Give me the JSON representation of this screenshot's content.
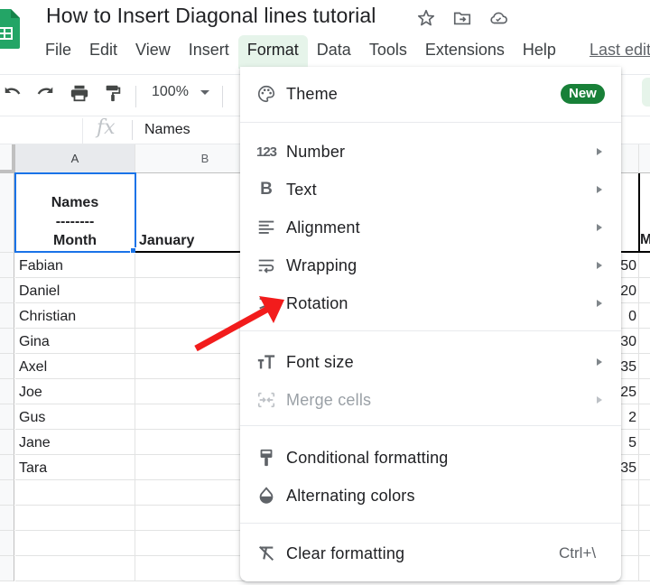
{
  "app": {
    "title": "How to Insert Diagonal lines tutorial",
    "title_icons": [
      "star-icon",
      "move-to-folder-icon",
      "cloud-saved-icon"
    ],
    "last_edit_label": "Last edit",
    "brand_color": "#188038"
  },
  "menubar": {
    "items": [
      {
        "label": "File"
      },
      {
        "label": "Edit"
      },
      {
        "label": "View"
      },
      {
        "label": "Insert"
      },
      {
        "label": "Format",
        "active": true
      },
      {
        "label": "Data"
      },
      {
        "label": "Tools"
      },
      {
        "label": "Extensions"
      },
      {
        "label": "Help"
      }
    ]
  },
  "toolbar": {
    "icons": [
      "undo-icon",
      "redo-icon",
      "print-icon",
      "paint-format-icon"
    ],
    "zoom": "100%"
  },
  "formula_bar": {
    "fx_label": "fx",
    "value": "Names"
  },
  "sheet": {
    "columns": [
      "A",
      "B"
    ],
    "selected_cell": "A1",
    "a1_lines": [
      "Names",
      "--------",
      "Month"
    ],
    "b1": "January",
    "right_header_partial": "M",
    "names": [
      "Fabian",
      "Daniel",
      "Christian",
      "Gina",
      "Axel",
      "Joe",
      "Gus",
      "Jane",
      "Tara"
    ],
    "right_partial_values": [
      "50",
      "20",
      "0",
      "30",
      "35",
      "25",
      "2",
      "5",
      "35"
    ]
  },
  "format_menu": {
    "items": [
      {
        "label": "Theme",
        "icon": "palette-icon",
        "badge": "New"
      },
      {
        "label": "Number",
        "icon": "number-123-icon",
        "submenu": true
      },
      {
        "label": "Text",
        "icon": "bold-icon",
        "submenu": true
      },
      {
        "label": "Alignment",
        "icon": "align-left-icon",
        "submenu": true
      },
      {
        "label": "Wrapping",
        "icon": "text-wrap-icon",
        "submenu": true
      },
      {
        "label": "Rotation",
        "icon": "text-rotation-icon",
        "submenu": true
      },
      {
        "label": "Font size",
        "icon": "font-size-icon",
        "submenu": true
      },
      {
        "label": "Merge cells",
        "icon": "merge-cells-icon",
        "submenu": true,
        "disabled": true
      },
      {
        "label": "Conditional formatting",
        "icon": "conditional-format-icon"
      },
      {
        "label": "Alternating colors",
        "icon": "alternating-colors-icon"
      },
      {
        "label": "Clear formatting",
        "icon": "clear-format-icon",
        "shortcut": "Ctrl+\\"
      }
    ]
  },
  "annotation": {
    "arrow_color": "#f21c1c",
    "points_to": "Rotation"
  }
}
